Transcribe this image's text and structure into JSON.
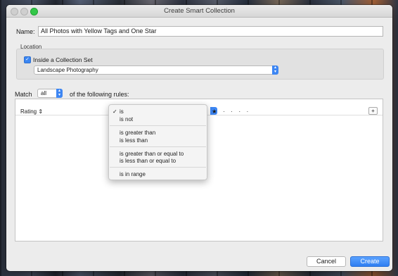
{
  "window": {
    "title": "Create Smart Collection"
  },
  "name": {
    "label": "Name:",
    "value": "All Photos with Yellow Tags and One Star"
  },
  "location": {
    "label": "Location",
    "inside_set_label": "Inside a Collection Set",
    "inside_set_checked": true,
    "set_value": "Landscape Photography"
  },
  "match": {
    "prefix": "Match",
    "value": "all",
    "suffix": "of the following rules:"
  },
  "rule": {
    "field": "Rating",
    "stars": "★ · · · ·",
    "add_label": "+"
  },
  "operator_menu": {
    "items": [
      "is",
      "is not",
      "is greater than",
      "is less than",
      "is greater than or equal to",
      "is less than or equal to",
      "is in range"
    ],
    "selected": "is"
  },
  "buttons": {
    "cancel": "Cancel",
    "create": "Create"
  }
}
